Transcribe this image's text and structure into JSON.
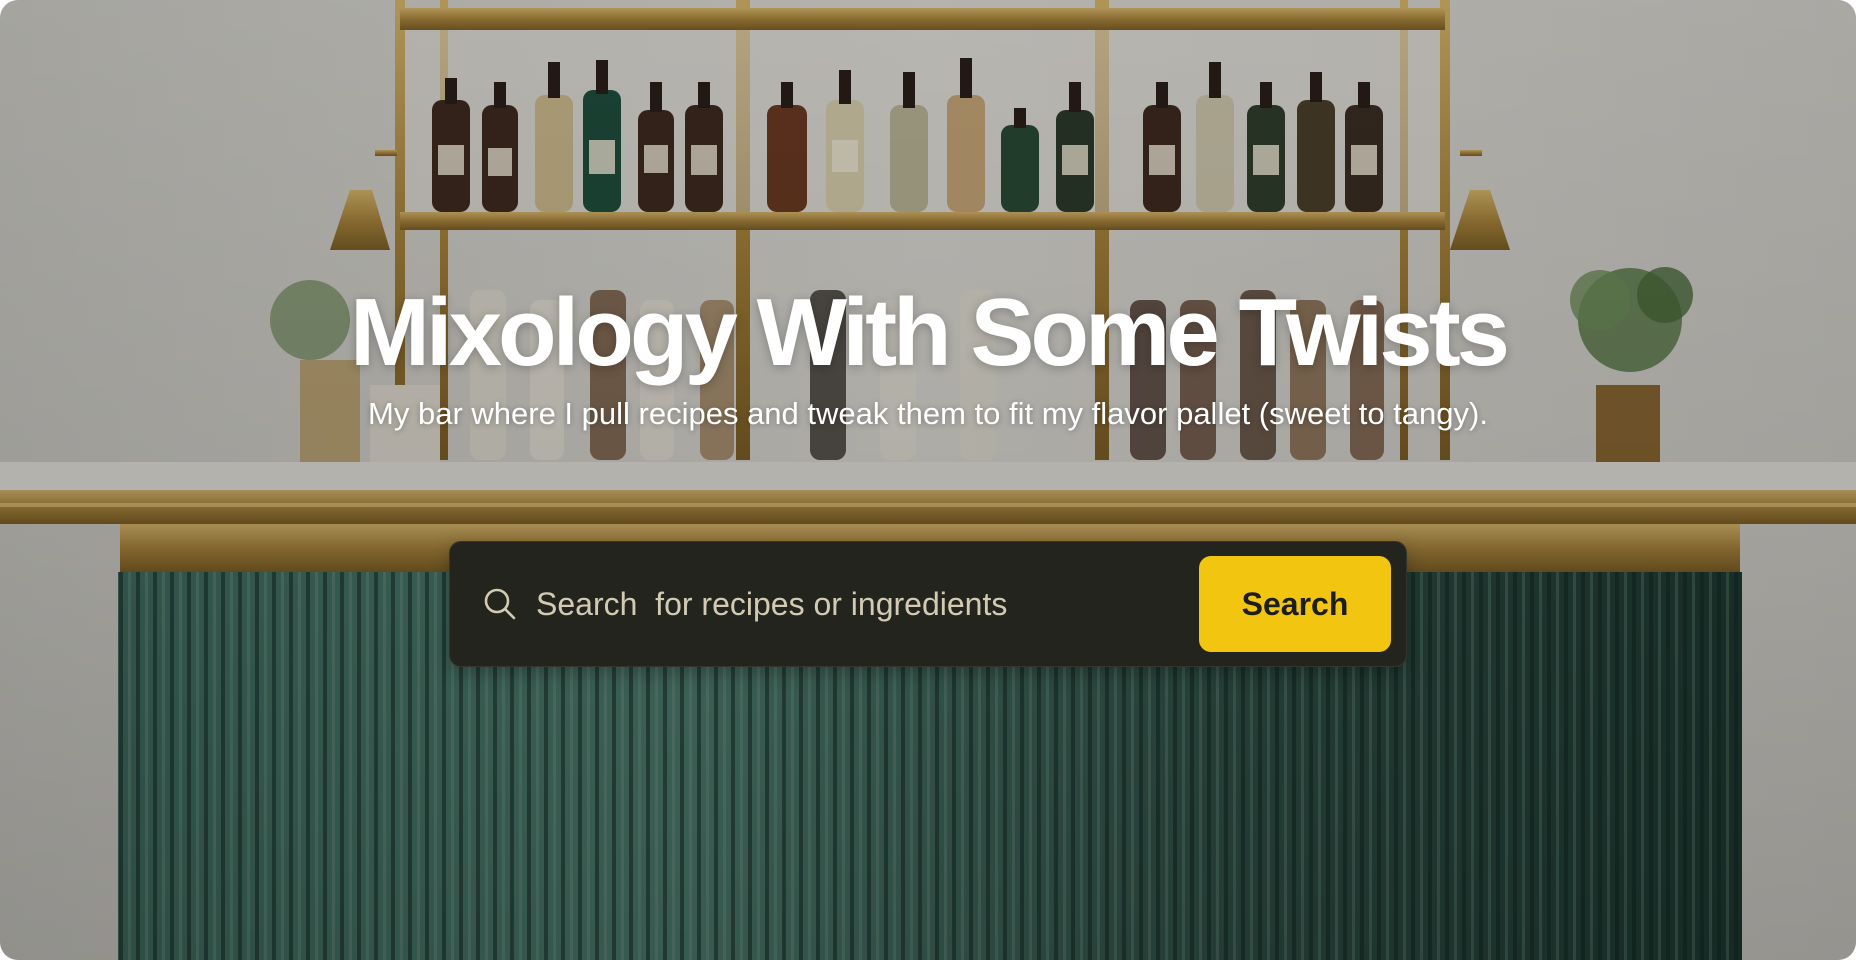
{
  "hero": {
    "title": "Mixology With Some Twists",
    "subtitle": "My bar where I pull recipes and tweak them to fit my flavor pallet (sweet to tangy)."
  },
  "search": {
    "placeholder": "Search  for recipes or ingredients",
    "value": "",
    "button_label": "Search",
    "icon": "search-icon"
  },
  "colors": {
    "search_bar_bg": "#24241e",
    "search_button_bg": "#f2c511",
    "title_text": "#ffffff",
    "bar_counter_green": "#2f4e44",
    "brass": "#b08a3e"
  }
}
